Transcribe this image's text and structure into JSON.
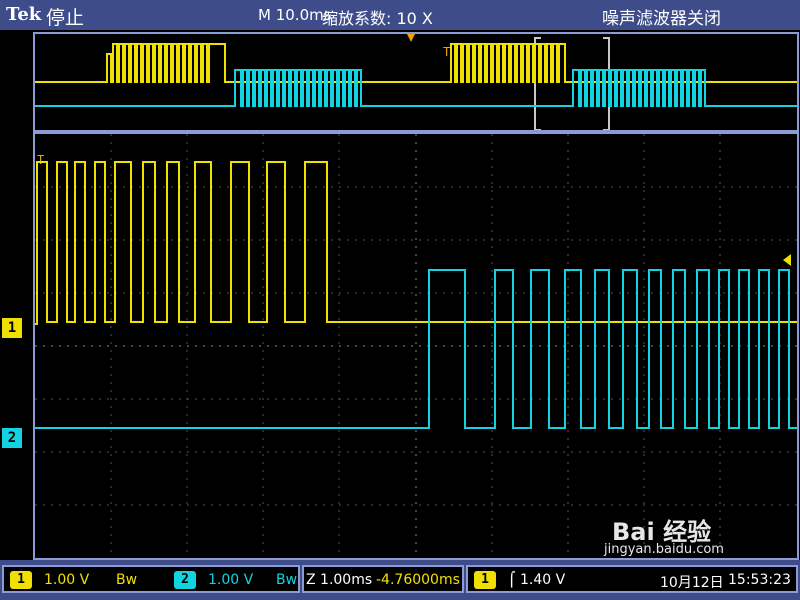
{
  "header": {
    "brand": "Tek",
    "status": "停止",
    "timebase": "M 10.0ms",
    "zoom_label": "缩放系数: 10 X",
    "noise_filter": "噪声滤波器关闭"
  },
  "channels": [
    {
      "id": "1",
      "color": "#f0e000",
      "marker": "1"
    },
    {
      "id": "2",
      "color": "#12d4e0",
      "marker": "2"
    }
  ],
  "footer": {
    "ch1_chip": "1",
    "ch1_scale": "1.00 V",
    "ch1_bw": "Bw",
    "ch2_chip": "2",
    "ch2_scale": "1.00 V",
    "ch2_bw": "Bw",
    "zoom_time": "Z 1.00ms",
    "zoom_offset": "-4.76000ms",
    "trig_chip": "1",
    "trig_level": "1.40 V",
    "date": "10月12日",
    "time": "15:53:23"
  },
  "watermark": {
    "logo": "Bai 经验",
    "url": "jingyan.baidu.com"
  },
  "colors": {
    "ch1": "#f0e000",
    "ch2": "#12d4e0",
    "frame": "#8b9bd4",
    "bar": "#3e4d8a"
  }
}
